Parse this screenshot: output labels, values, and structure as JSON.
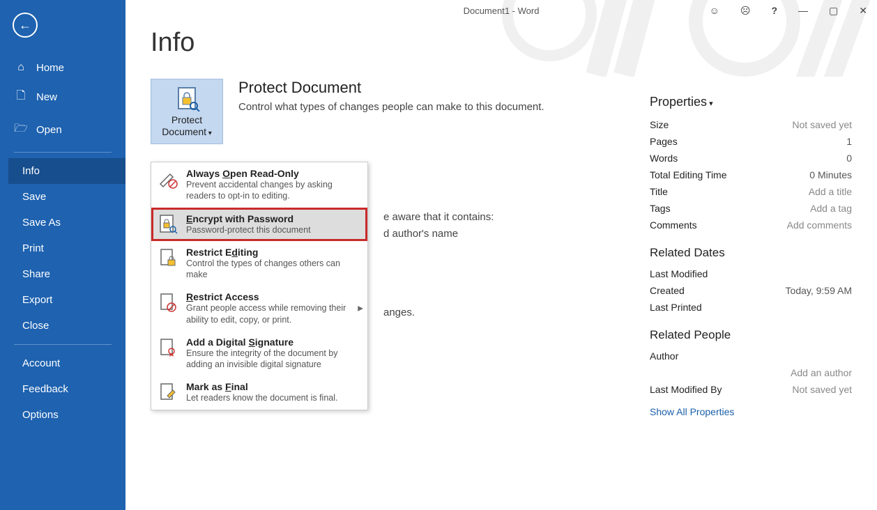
{
  "title": "Document1  -  Word",
  "page_heading": "Info",
  "sidebar": {
    "home": "Home",
    "new": "New",
    "open": "Open",
    "info": "Info",
    "save": "Save",
    "saveas": "Save As",
    "print": "Print",
    "share": "Share",
    "export": "Export",
    "close": "Close",
    "account": "Account",
    "feedback": "Feedback",
    "options": "Options"
  },
  "protect": {
    "button_label": "Protect Document",
    "heading": "Protect Document",
    "desc": "Control what types of changes people can make to this document."
  },
  "dropdown": {
    "readonly": {
      "title_pre": "Always ",
      "title_ul": "O",
      "title_post": "pen Read-Only",
      "desc": "Prevent accidental changes by asking readers to opt-in to editing."
    },
    "encrypt": {
      "title_pre": "",
      "title_ul": "E",
      "title_post": "ncrypt with Password",
      "desc": "Password-protect this document"
    },
    "restrict_edit": {
      "title_pre": "Restrict E",
      "title_ul": "d",
      "title_post": "iting",
      "desc": "Control the types of changes others can make"
    },
    "restrict_access": {
      "title_pre": "",
      "title_ul": "R",
      "title_post": "estrict Access",
      "desc": "Grant people access while removing their ability to edit, copy, or print."
    },
    "signature": {
      "title_pre": "Add a Digital ",
      "title_ul": "S",
      "title_post": "ignature",
      "desc": "Ensure the integrity of the document by adding an invisible digital signature"
    },
    "final": {
      "title_pre": "Mark as ",
      "title_ul": "F",
      "title_post": "inal",
      "desc": "Let readers know the document is final."
    }
  },
  "behind": {
    "line1": "e aware that it contains:",
    "line2": "d author's name",
    "line3": "anges."
  },
  "properties": {
    "header": "Properties",
    "size": {
      "label": "Size",
      "value": "Not saved yet"
    },
    "pages": {
      "label": "Pages",
      "value": "1"
    },
    "words": {
      "label": "Words",
      "value": "0"
    },
    "edit_time": {
      "label": "Total Editing Time",
      "value": "0 Minutes"
    },
    "title": {
      "label": "Title",
      "value": "Add a title"
    },
    "tags": {
      "label": "Tags",
      "value": "Add a tag"
    },
    "comments": {
      "label": "Comments",
      "value": "Add comments"
    },
    "related_dates": "Related Dates",
    "last_modified": {
      "label": "Last Modified",
      "value": ""
    },
    "created": {
      "label": "Created",
      "value": "Today, 9:59 AM"
    },
    "last_printed": {
      "label": "Last Printed",
      "value": ""
    },
    "related_people": "Related People",
    "author": {
      "label": "Author",
      "value": ""
    },
    "add_author": "Add an author",
    "last_modified_by": {
      "label": "Last Modified By",
      "value": "Not saved yet"
    },
    "show_all": "Show All Properties"
  }
}
